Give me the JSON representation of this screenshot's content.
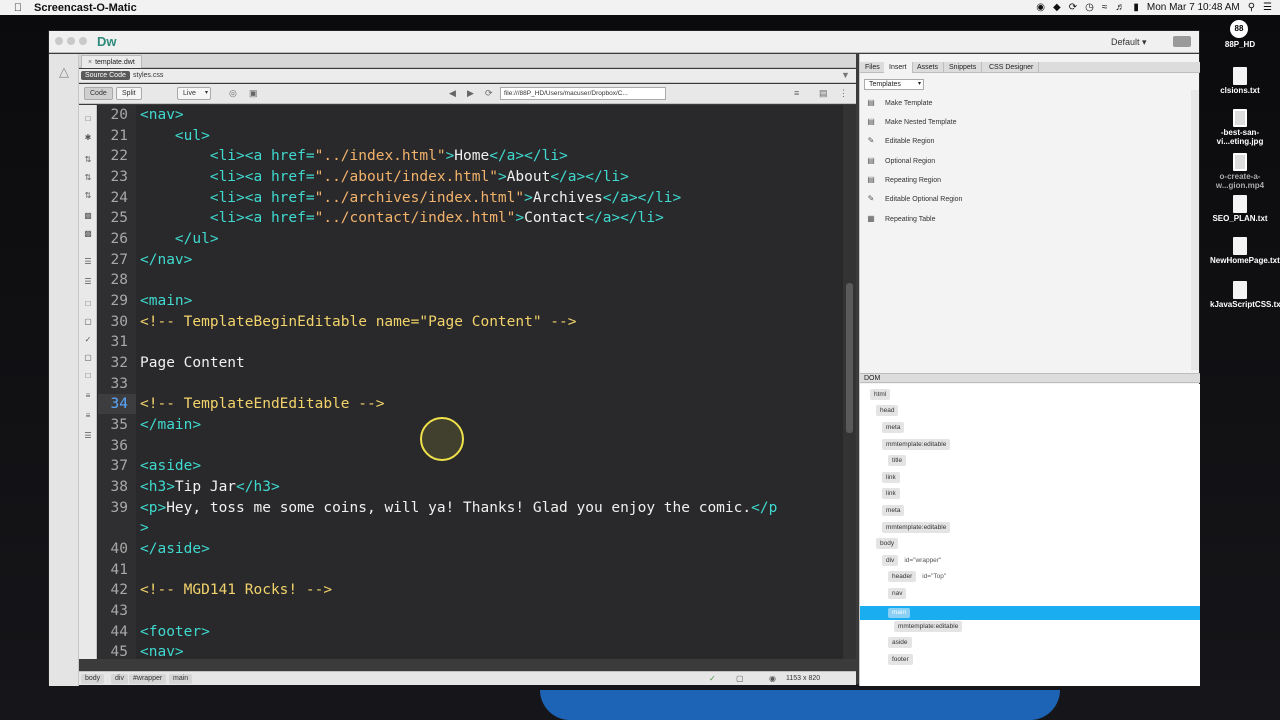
{
  "menubar": {
    "app_name": "Screencast-O-Matic",
    "clock": "Mon Mar 7  10:48 AM"
  },
  "desktop": {
    "badge": "88",
    "user": "88P_HD",
    "files": [
      "clsions.txt",
      "-best-san-vi...eting.jpg",
      "o-create-a-w...gion.mp4",
      "SEO_PLAN.txt",
      "NewHomePage.txt",
      "kJavaScriptCSS.txt"
    ]
  },
  "window": {
    "logo": "Dw",
    "workspace": "Default"
  },
  "doc_tabs": [
    {
      "label": "template.dwt"
    }
  ],
  "related_files": {
    "source_code": "Source Code",
    "css": "styles.css"
  },
  "toolbar": {
    "code": "Code",
    "split": "Split",
    "live": "Live",
    "url": "file:///88P_HD/Users/macuser/Dropbox/C..."
  },
  "editor": {
    "current_line": "34",
    "lines": [
      {
        "n": "20"
      },
      {
        "n": "21"
      },
      {
        "n": "22"
      },
      {
        "n": "23"
      },
      {
        "n": "24"
      },
      {
        "n": "25"
      },
      {
        "n": "26"
      },
      {
        "n": "27"
      },
      {
        "n": "28"
      },
      {
        "n": "29"
      },
      {
        "n": "30"
      },
      {
        "n": "31"
      },
      {
        "n": "32"
      },
      {
        "n": "33"
      },
      {
        "n": "34"
      },
      {
        "n": "35"
      },
      {
        "n": "36"
      },
      {
        "n": "37"
      },
      {
        "n": "38"
      },
      {
        "n": "39"
      },
      {
        "n": ""
      },
      {
        "n": "40"
      },
      {
        "n": "41"
      },
      {
        "n": "42"
      },
      {
        "n": "43"
      },
      {
        "n": "44"
      },
      {
        "n": "45"
      }
    ],
    "code": {
      "l20": "<nav>",
      "l21": "    <ul>",
      "l22_a": "        <li><a href=",
      "l22_s": "\"../index.html\"",
      "l22_t": "Home",
      "l22_c": "</a></li>",
      "l23_a": "        <li><a href=",
      "l23_s": "\"../about/index.html\"",
      "l23_t": "About",
      "l23_c": "</a></li>",
      "l24_a": "        <li><a href=",
      "l24_s": "\"../archives/index.html\"",
      "l24_t": "Archives",
      "l24_c": "</a></li>",
      "l25_a": "        <li><a href=",
      "l25_s": "\"../contact/index.html\"",
      "l25_t": "Contact",
      "l25_c": "</a></li>",
      "l26": "    </ul>",
      "l27": "</nav>",
      "l29": "<main>",
      "l30": "<!-- TemplateBeginEditable name=\"Page Content\" -->",
      "l32": "Page Content",
      "l34": "<!-- TemplateEndEditable -->",
      "l35": "</main>",
      "l37": "<aside>",
      "l38_a": "<h3>",
      "l38_t": "Tip Jar",
      "l38_c": "</h3>",
      "l39_a": "<p>",
      "l39_t": "Hey, toss me some coins, will ya! Thanks! Glad you enjoy the comic.",
      "l39_c": "</p",
      "l39b": ">",
      "l40": "</aside>",
      "l42": "<!-- MGD141 Rocks! -->",
      "l44": "<footer>",
      "l45": "<nav>"
    }
  },
  "status": {
    "crumbs": [
      "body",
      "div",
      "#wrapper",
      "main"
    ],
    "dimensions": "1153 x 820"
  },
  "panel": {
    "tabs": [
      "Files",
      "Insert",
      "Assets",
      "Snippets",
      "CSS Designer"
    ],
    "active_tab": "Insert",
    "category": "Templates",
    "insert_items": [
      "Make Template",
      "Make Nested Template",
      "Editable Region",
      "Optional Region",
      "Repeating Region",
      "Editable Optional Region",
      "Repeating Table"
    ],
    "dom_title": "DOM",
    "dom": {
      "html": "html",
      "head": "head",
      "meta1": "meta",
      "mm1": "mmtemplate:editable",
      "title": "title",
      "link1": "link",
      "link2": "link",
      "meta2": "meta",
      "mm2": "mmtemplate:editable",
      "body": "body",
      "div": "div",
      "div_id": "id=\"wrapper\"",
      "header": "header",
      "header_id": "id=\"Top\"",
      "nav": "nav",
      "main": "main",
      "mm3": "mmtemplate:editable",
      "aside": "aside",
      "footer": "footer"
    }
  },
  "colors": {
    "selection": "#1aaef0",
    "tag": "#3fd9cf",
    "string": "#f2b26b",
    "comment": "#f2d36b"
  }
}
